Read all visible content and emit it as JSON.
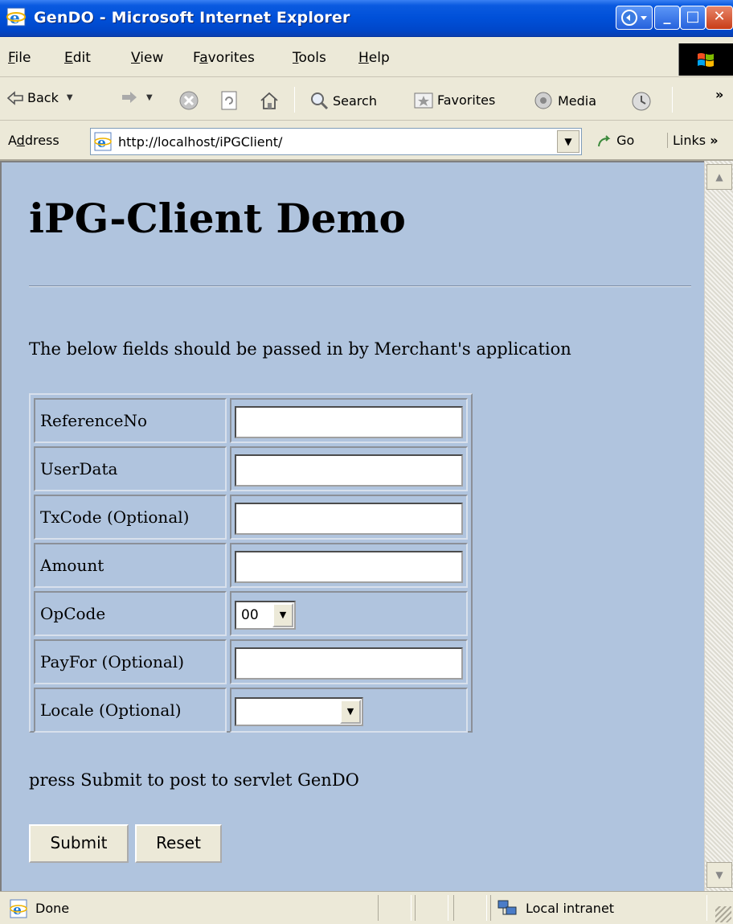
{
  "window": {
    "title": "GenDO - Microsoft Internet Explorer",
    "controls": {
      "help_icon": "help-globe-icon",
      "minimize": "_",
      "maximize": "□",
      "close": "✕"
    }
  },
  "menu": {
    "items": [
      {
        "label": "File",
        "accel": "F",
        "rest": "ile"
      },
      {
        "label": "Edit",
        "accel": "E",
        "rest": "dit"
      },
      {
        "label": "View",
        "accel": "V",
        "rest": "iew"
      },
      {
        "label": "Favorites",
        "pre": "F",
        "accel": "a",
        "rest": "vorites"
      },
      {
        "label": "Tools",
        "accel": "T",
        "rest": "ools"
      },
      {
        "label": "Help",
        "accel": "H",
        "rest": "elp"
      }
    ]
  },
  "toolbar": {
    "back": "Back",
    "search": "Search",
    "favorites": "Favorites",
    "media": "Media",
    "chevron": "»"
  },
  "address": {
    "label_pre": "A",
    "label_accel": "d",
    "label_rest": "dress",
    "url": "http://localhost/iPGClient/",
    "go": "Go",
    "links": "Links",
    "links_chevron": "»"
  },
  "page": {
    "heading": "iPG-Client Demo",
    "intro": "The below fields should be passed in by Merchant's application",
    "fields": [
      {
        "label": "ReferenceNo",
        "type": "text",
        "value": ""
      },
      {
        "label": "UserData",
        "type": "text",
        "value": ""
      },
      {
        "label": "TxCode (Optional)",
        "type": "text",
        "value": ""
      },
      {
        "label": "Amount",
        "type": "text",
        "value": ""
      },
      {
        "label": "OpCode",
        "type": "select",
        "value": "00"
      },
      {
        "label": "PayFor (Optional)",
        "type": "text",
        "value": ""
      },
      {
        "label": "Locale (Optional)",
        "type": "select",
        "value": ""
      }
    ],
    "note": "press Submit to post to servlet GenDO",
    "submit": "Submit",
    "reset": "Reset",
    "background": "#b0c4de"
  },
  "status": {
    "text": "Done",
    "zone": "Local intranet"
  }
}
